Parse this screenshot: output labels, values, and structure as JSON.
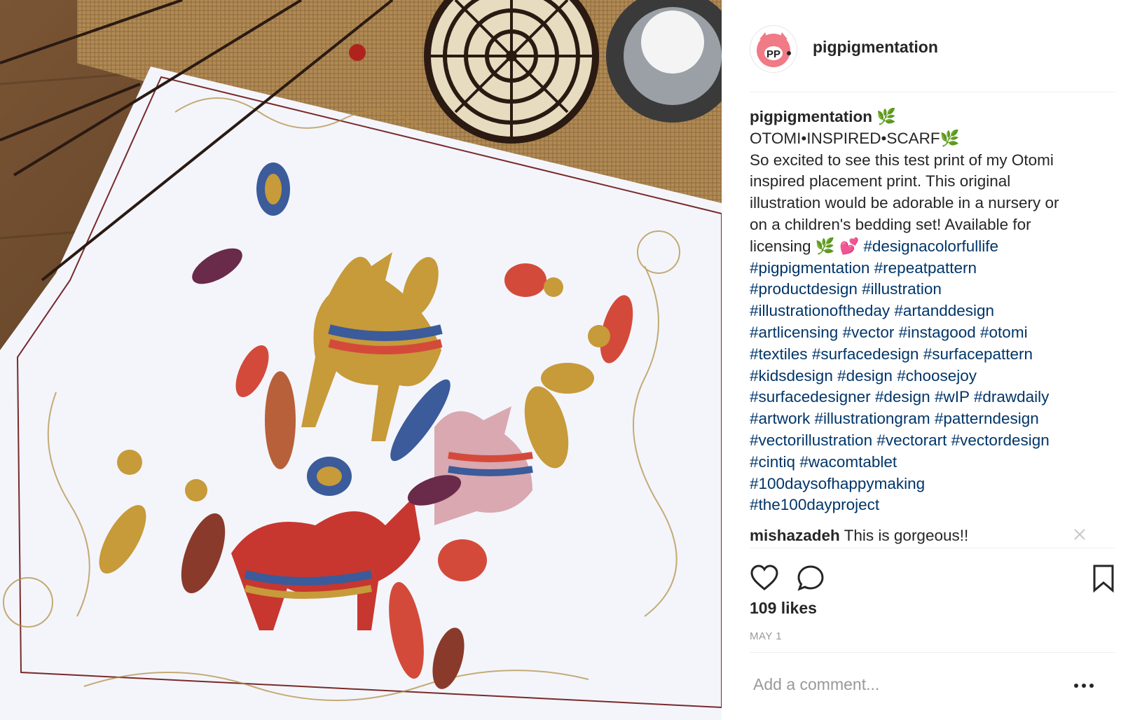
{
  "post": {
    "username": "pigpigmentation",
    "avatar_icon": "pig-face-icon",
    "caption_lines": [
      {
        "parts": [
          {
            "t": "user",
            "v": "pigpigmentation"
          },
          {
            "t": "text",
            "v": " 🌿"
          }
        ]
      },
      {
        "parts": [
          {
            "t": "text",
            "v": "OTOMI•INSPIRED•SCARF🌿"
          }
        ]
      },
      {
        "parts": [
          {
            "t": "text",
            "v": "So excited to see this test print of my Otomi"
          }
        ]
      },
      {
        "parts": [
          {
            "t": "text",
            "v": "inspired placement print. This original"
          }
        ]
      },
      {
        "parts": [
          {
            "t": "text",
            "v": "illustration would be adorable in a nursery or"
          }
        ]
      },
      {
        "parts": [
          {
            "t": "text",
            "v": "on a children's bedding set! Available for"
          }
        ]
      },
      {
        "parts": [
          {
            "t": "text",
            "v": "licensing 🌿 💕 "
          },
          {
            "t": "tag",
            "v": "#designacolorfullife"
          }
        ]
      },
      {
        "parts": [
          {
            "t": "tag",
            "v": "#pigpigmentation"
          },
          {
            "t": "text",
            "v": " "
          },
          {
            "t": "tag",
            "v": "#repeatpattern"
          }
        ]
      },
      {
        "parts": [
          {
            "t": "tag",
            "v": "#productdesign"
          },
          {
            "t": "text",
            "v": " "
          },
          {
            "t": "tag",
            "v": "#illustration"
          }
        ]
      },
      {
        "parts": [
          {
            "t": "tag",
            "v": "#illustrationoftheday"
          },
          {
            "t": "text",
            "v": " "
          },
          {
            "t": "tag",
            "v": "#artanddesign"
          }
        ]
      },
      {
        "parts": [
          {
            "t": "tag",
            "v": "#artlicensing"
          },
          {
            "t": "text",
            "v": " "
          },
          {
            "t": "tag",
            "v": "#vector"
          },
          {
            "t": "text",
            "v": " "
          },
          {
            "t": "tag",
            "v": "#instagood"
          },
          {
            "t": "text",
            "v": " "
          },
          {
            "t": "tag",
            "v": "#otomi"
          }
        ]
      },
      {
        "parts": [
          {
            "t": "tag",
            "v": "#textiles"
          },
          {
            "t": "text",
            "v": " "
          },
          {
            "t": "tag",
            "v": "#surfacedesign"
          },
          {
            "t": "text",
            "v": " "
          },
          {
            "t": "tag",
            "v": "#surfacepattern"
          }
        ]
      },
      {
        "parts": [
          {
            "t": "tag",
            "v": "#kidsdesign"
          },
          {
            "t": "text",
            "v": " "
          },
          {
            "t": "tag",
            "v": "#design"
          },
          {
            "t": "text",
            "v": " "
          },
          {
            "t": "tag",
            "v": "#choosejoy"
          }
        ]
      },
      {
        "parts": [
          {
            "t": "tag",
            "v": "#surfacedesigner"
          },
          {
            "t": "text",
            "v": " "
          },
          {
            "t": "tag",
            "v": "#design"
          },
          {
            "t": "text",
            "v": " "
          },
          {
            "t": "tag",
            "v": "#wIP"
          },
          {
            "t": "text",
            "v": " "
          },
          {
            "t": "tag",
            "v": "#drawdaily"
          }
        ]
      },
      {
        "parts": [
          {
            "t": "tag",
            "v": "#artwork"
          },
          {
            "t": "text",
            "v": " "
          },
          {
            "t": "tag",
            "v": "#illustrationgram"
          },
          {
            "t": "text",
            "v": " "
          },
          {
            "t": "tag",
            "v": "#patterndesign"
          }
        ]
      },
      {
        "parts": [
          {
            "t": "tag",
            "v": "#vectorillustration"
          },
          {
            "t": "text",
            "v": " "
          },
          {
            "t": "tag",
            "v": "#vectorart"
          },
          {
            "t": "text",
            "v": " "
          },
          {
            "t": "tag",
            "v": "#vectordesign"
          }
        ]
      },
      {
        "parts": [
          {
            "t": "tag",
            "v": "#cintiq"
          },
          {
            "t": "text",
            "v": " "
          },
          {
            "t": "tag",
            "v": "#wacomtablet"
          }
        ]
      },
      {
        "parts": [
          {
            "t": "tag",
            "v": "#100daysofhappymaking"
          }
        ]
      },
      {
        "parts": [
          {
            "t": "tag",
            "v": "#the100dayproject"
          }
        ]
      }
    ],
    "comment": {
      "user": "mishazadeh",
      "text": "This is gorgeous!!"
    },
    "likes": "109 likes",
    "date": "MAY 1",
    "add_comment_placeholder": "Add a comment...",
    "icons": {
      "like": "heart-icon",
      "comment": "comment-bubble-icon",
      "save": "bookmark-icon",
      "more": "more-dots-icon",
      "close": "close-icon"
    }
  },
  "colors": {
    "hashtag": "#003569",
    "text": "#262626",
    "muted": "#999999",
    "divider": "#efefef"
  }
}
